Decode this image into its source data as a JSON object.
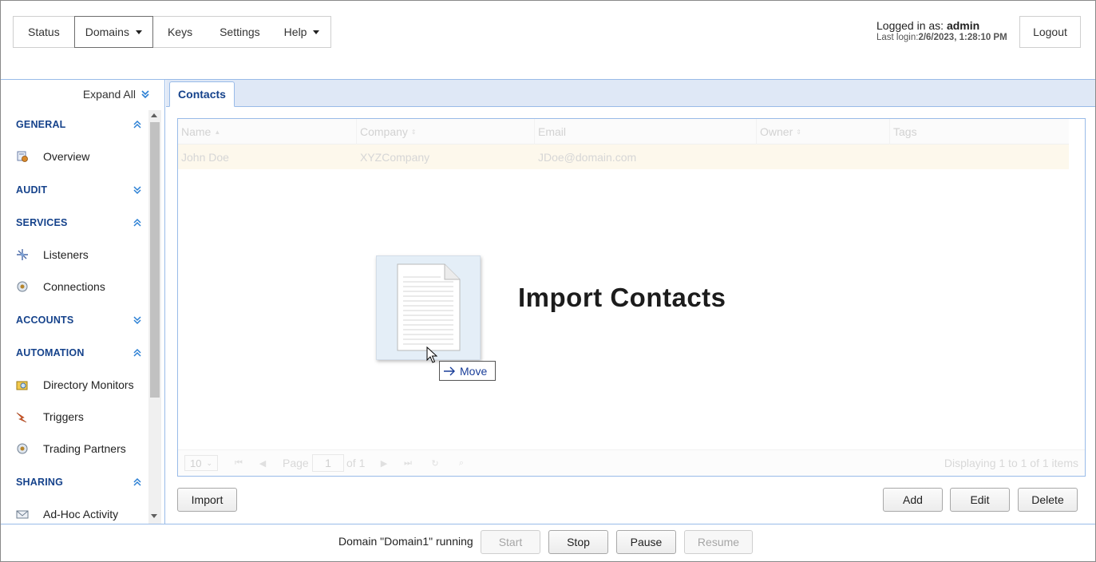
{
  "nav": {
    "status": "Status",
    "domains": "Domains",
    "keys": "Keys",
    "settings": "Settings",
    "help": "Help"
  },
  "login": {
    "label": "Logged in as: ",
    "user": "admin",
    "last_label": "Last login:",
    "last_value": "2/6/2023, 1:28:10 PM",
    "logout": "Logout"
  },
  "sidebar": {
    "expand_all": "Expand All",
    "sections": {
      "general": "GENERAL",
      "audit": "AUDIT",
      "services": "SERVICES",
      "accounts": "ACCOUNTS",
      "automation": "AUTOMATION",
      "sharing": "SHARING"
    },
    "items": {
      "overview": "Overview",
      "listeners": "Listeners",
      "connections": "Connections",
      "directory_monitors": "Directory Monitors",
      "triggers": "Triggers",
      "trading_partners": "Trading Partners",
      "adhoc": "Ad-Hoc Activity"
    }
  },
  "tab": {
    "contacts": "Contacts"
  },
  "grid": {
    "columns": [
      "Name",
      "Company",
      "Email",
      "Owner",
      "Tags"
    ],
    "rows": [
      {
        "name": "John Doe",
        "company": "XYZCompany",
        "email": "JDoe@domain.com",
        "owner": "",
        "tags": ""
      }
    ]
  },
  "pager": {
    "page_size": "10",
    "page_label": "Page",
    "page": "1",
    "of": "of 1",
    "displaying": "Displaying 1 to 1 of 1 items"
  },
  "overlay": {
    "title": "Import Contacts",
    "move": "Move"
  },
  "buttons": {
    "import": "Import",
    "add": "Add",
    "edit": "Edit",
    "delete": "Delete"
  },
  "status_bar": {
    "text": "Domain \"Domain1\" running",
    "start": "Start",
    "stop": "Stop",
    "pause": "Pause",
    "resume": "Resume"
  }
}
